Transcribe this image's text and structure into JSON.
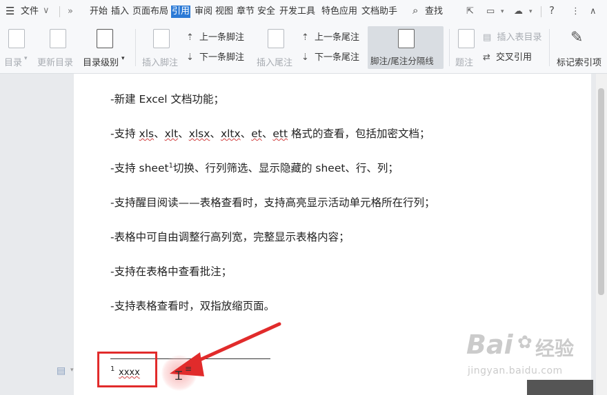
{
  "menubar": {
    "file_label": "文件",
    "tabs": [
      "开始",
      "插入",
      "页面布局",
      "引用",
      "审阅",
      "视图",
      "章节",
      "安全",
      "开发工具",
      "特色应用",
      "文档助手"
    ],
    "active_tab": "引用",
    "search_label": "查找"
  },
  "ribbon": {
    "toc_label": "目录",
    "update_toc_label": "更新目录",
    "toc_level_label": "目录级别",
    "insert_footnote_label": "插入脚注",
    "prev_footnote_label": "上一条脚注",
    "next_footnote_label": "下一条脚注",
    "insert_endnote_label": "插入尾注",
    "prev_endnote_label": "上一条尾注",
    "next_endnote_label": "下一条尾注",
    "separator_label": "脚注/尾注分隔线",
    "caption_label": "题注",
    "insert_table_toc_label": "插入表目录",
    "cross_ref_label": "交叉引用",
    "mark_index_label": "标记索引项"
  },
  "document": {
    "lines": [
      {
        "pre": "-新建 Excel 文档功能；"
      },
      {
        "pre": "-支持 ",
        "w1": "xls",
        "s1": "、",
        "w2": "xlt",
        "s2": "、",
        "w3": "xlsx",
        "s3": "、",
        "w4": "xltx",
        "s4": "、",
        "w5": "et",
        "s5": "、",
        "w6": "ett",
        "post": " 格式的查看，包括加密文档；"
      },
      {
        "pre": "-支持 sheet",
        "sup": "1",
        "post": "切换、行列筛选、显示隐藏的 sheet、行、列；"
      },
      {
        "pre": "-支持醒目阅读——表格查看时，支持高亮显示活动单元格所在行列；"
      },
      {
        "pre": "-表格中可自由调整行高列宽，完整显示表格内容；"
      },
      {
        "pre": "-支持在表格中查看批注；"
      },
      {
        "pre": "-支持表格查看时，双指放缩页面。"
      }
    ],
    "footnote": {
      "number": "1",
      "text": "xxxx"
    }
  },
  "watermark": {
    "brand": "Bai",
    "brand2": "经验",
    "url": "jingyan.baidu.com"
  },
  "colors": {
    "accent": "#2b7ad6",
    "highlight_red": "#e12b2b"
  }
}
